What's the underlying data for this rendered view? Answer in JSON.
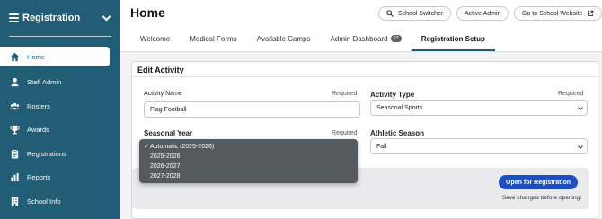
{
  "sidebar": {
    "title": "Registration",
    "items": [
      {
        "label": "Home",
        "icon": "home-icon",
        "active": true
      },
      {
        "label": "Staff Admin",
        "icon": "person-icon"
      },
      {
        "label": "Rosters",
        "icon": "group-icon"
      },
      {
        "label": "Awards",
        "icon": "trophy-icon"
      },
      {
        "label": "Registrations",
        "icon": "clipboard-icon"
      },
      {
        "label": "Reports",
        "icon": "bar-chart-icon"
      },
      {
        "label": "School Info",
        "icon": "building-icon"
      }
    ]
  },
  "header": {
    "title": "Home",
    "school_switcher": "School Switcher",
    "active_admin": "Active Admin",
    "school_website": "Go to School Website",
    "tabs": [
      "Welcome",
      "Medical Forms",
      "Available Camps",
      "Admin Dashboard",
      "Registration Setup"
    ],
    "admin_badge": "27",
    "active_tab": "Registration Setup"
  },
  "card": {
    "title": "Edit Activity",
    "activity_name_label": "Activity Name",
    "activity_name_required": "Required",
    "activity_name_value": "Flag Football",
    "activity_type_label": "Activity Type",
    "activity_type_required": "Required",
    "activity_type_value": "Seasonal Sports",
    "seasonal_year_label": "Seasonal Year",
    "seasonal_year_required": "Required",
    "athletic_season_label": "Athletic Season",
    "athletic_season_value": "Fall",
    "open_button": "Open for Registration",
    "open_note": "Save changes before opening!"
  },
  "year_dropdown": {
    "options": [
      "Automatic (2025-2026)",
      "2025-2026",
      "2026-2027",
      "2027-2028"
    ],
    "selected": "Automatic (2025-2026)",
    "check": "✓"
  },
  "colors": {
    "sidebar": "#215d75",
    "primary_button": "#1d4fc4"
  }
}
